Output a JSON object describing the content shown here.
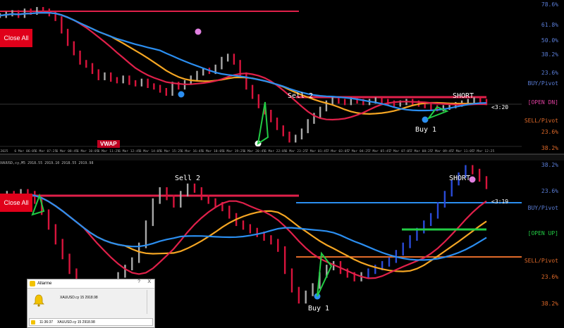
{
  "app": {
    "close_all_label": "Close All",
    "vwap_label": "VWAP",
    "symbol_header": "XAUUSD,cy,M5 2918.55 2919.10 2918.55 2919.98"
  },
  "colors": {
    "background": "#000000",
    "price_up": "#2a4bd8",
    "price_down": "#d8143c",
    "price_neutral": "#a8a8a8",
    "vwap_red": "#e0204a",
    "ma_orange": "#f5a623",
    "ma_blue": "#2b8ef0",
    "signal_green": "#22cc44",
    "level_label_blue": "#5b7ed8",
    "level_label_orange": "#e06a2a"
  },
  "chart_data": [
    {
      "type": "line",
      "title": "",
      "x_ticks": [
        "2025",
        "6 Mar 06:05",
        "6 Mar 07:25",
        "6 Mar 08:45",
        "6 Mar 10:05",
        "6 Mar 11:25",
        "6 Mar 12:45",
        "6 Mar 14:05",
        "6 Mar 15:25",
        "6 Mar 16:45",
        "6 Mar 18:05",
        "6 Mar 19:25",
        "6 Mar 20:45",
        "6 Mar 22:05",
        "6 Mar 23:25",
        "7 Mar 01:45",
        "7 Mar 03:05",
        "7 Mar 04:25",
        "7 Mar 05:45",
        "7 Mar 07:05",
        "7 Mar 08:25",
        "7 Mar 09:45",
        "7 Mar 11:05",
        "7 Mar 12:25"
      ],
      "levels": [
        {
          "label": "78.6%",
          "color": "#5b7ed8"
        },
        {
          "label": "61.8%",
          "color": "#5b7ed8"
        },
        {
          "label": "50.0%",
          "color": "#5b7ed8"
        },
        {
          "label": "38.2%",
          "color": "#5b7ed8"
        },
        {
          "label": "23.6%",
          "color": "#5b7ed8"
        },
        {
          "label": "BUY/Pivot",
          "color": "#5b7ed8"
        },
        {
          "label": "[OPEN DN]",
          "color": "#e040a0"
        },
        {
          "label": "SELL/Pivot",
          "color": "#e06a2a"
        },
        {
          "label": "23.6%",
          "color": "#e06a2a"
        },
        {
          "label": "38.2%",
          "color": "#e06a2a"
        }
      ],
      "current_price_label": "<3:20",
      "annotations": [
        "Sell 2",
        "SHORT",
        "Buy 1"
      ],
      "price_series": [
        70,
        71,
        72,
        70,
        73,
        72,
        74,
        73,
        71,
        68,
        60,
        52,
        46,
        40,
        38,
        34,
        30,
        32,
        29,
        28,
        30,
        27,
        26,
        28,
        25,
        24,
        22,
        20,
        26,
        24,
        27,
        30,
        33,
        35,
        34,
        37,
        42,
        44,
        40,
        32,
        24,
        18,
        12,
        8,
        3,
        -2,
        -6,
        -10,
        -8,
        -4,
        2,
        6,
        10,
        14,
        16,
        15,
        14,
        16,
        15,
        14,
        15,
        16,
        15,
        14,
        13,
        14,
        15,
        14,
        13,
        12,
        11,
        10,
        11,
        12,
        13,
        14,
        15,
        16,
        15,
        14
      ]
    },
    {
      "type": "line",
      "title": "",
      "levels": [
        {
          "label": "38.2%",
          "color": "#5b7ed8"
        },
        {
          "label": "23.6%",
          "color": "#5b7ed8"
        },
        {
          "label": "BUY/Pivot",
          "color": "#5b7ed8"
        },
        {
          "label": "[OPEN UP]",
          "color": "#22cc44"
        },
        {
          "label": "SELL/Pivot",
          "color": "#e06a2a"
        },
        {
          "label": "23.6%",
          "color": "#e06a2a"
        },
        {
          "label": "38.2%",
          "color": "#e06a2a"
        }
      ],
      "current_price_label": "<3:19",
      "annotations": [
        "Sell 2",
        "SHORT",
        "Buy 1"
      ],
      "price_series": [
        60,
        62,
        61,
        63,
        62,
        58,
        52,
        44,
        36,
        28,
        20,
        14,
        8,
        4,
        6,
        10,
        14,
        18,
        22,
        26,
        34,
        46,
        58,
        64,
        60,
        56,
        62,
        66,
        64,
        60,
        58,
        56,
        54,
        50,
        46,
        44,
        42,
        40,
        38,
        36,
        32,
        20,
        10,
        4,
        8,
        12,
        18,
        22,
        24,
        20,
        18,
        16,
        18,
        20,
        22,
        24,
        26,
        30,
        34,
        38,
        42,
        46,
        50,
        56,
        62,
        68,
        72,
        76,
        74,
        70,
        66
      ]
    }
  ],
  "alarm": {
    "title": "Allarme",
    "help": "?",
    "close": "X",
    "message": "XAUUSD.cy 15 2918.98",
    "row_time": "11:36:37",
    "row_message": "XAUUSD.cy 15 2918.98"
  }
}
